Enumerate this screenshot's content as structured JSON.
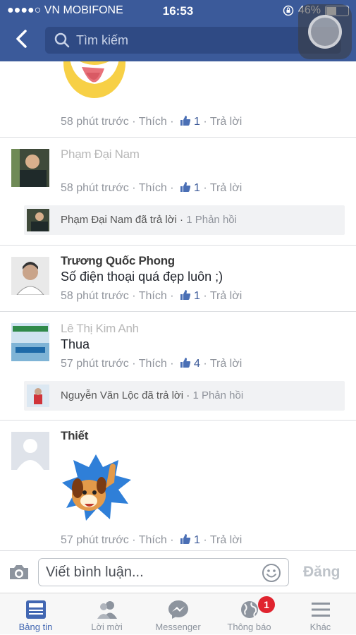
{
  "status_bar": {
    "carrier": "●●●●○ VN MOBIFONE",
    "time": "16:53",
    "battery": "46%",
    "battery_level": 0.46
  },
  "header": {
    "search_placeholder": "Tìm kiếm"
  },
  "comments": [
    {
      "name": "",
      "text": "",
      "time": "58 phút trước",
      "like_label": "Thích",
      "likes": "1",
      "reply_label": "Trả lời",
      "sticker": "tongue-emoji"
    },
    {
      "name": "Phạm Đại Nam",
      "text": "",
      "time": "58 phút trước",
      "like_label": "Thích",
      "likes": "1",
      "reply_label": "Trả lời",
      "reply_summary": {
        "text": "Phạm Đại Nam đã trả lời",
        "count": "1 Phản hồi"
      }
    },
    {
      "name": "Trương Quốc Phong",
      "text": "Số điện thoại quá đẹp luôn ;)",
      "time": "58 phút trước",
      "like_label": "Thích",
      "likes": "1",
      "reply_label": "Trả lời"
    },
    {
      "name": "Lê Thị Kim Anh",
      "text": "Thua",
      "time": "57 phút trước",
      "like_label": "Thích",
      "likes": "4",
      "reply_label": "Trả lời",
      "reply_summary": {
        "text": "Nguyễn Văn Lộc đã trả lời",
        "count": "1 Phản hồi"
      }
    },
    {
      "name": "Thiết",
      "text": "",
      "time": "57 phút trước",
      "like_label": "Thích",
      "likes": "1",
      "reply_label": "Trả lời",
      "sticker": "dog-thumbs-up"
    }
  ],
  "composer": {
    "placeholder": "Viết bình luận...",
    "post_label": "Đăng"
  },
  "tabbar": {
    "tabs": [
      {
        "label": "Bảng tin",
        "icon": "news-feed-icon",
        "active": true
      },
      {
        "label": "Lời mời",
        "icon": "friend-requests-icon"
      },
      {
        "label": "Messenger",
        "icon": "messenger-icon"
      },
      {
        "label": "Thông báo",
        "icon": "globe-icon"
      },
      {
        "label": "Khác",
        "icon": "menu-icon"
      }
    ],
    "notification_badge": "1"
  },
  "colors": {
    "brand": "#3b5a9a",
    "link": "#4267b2",
    "badge": "#e0242f"
  }
}
